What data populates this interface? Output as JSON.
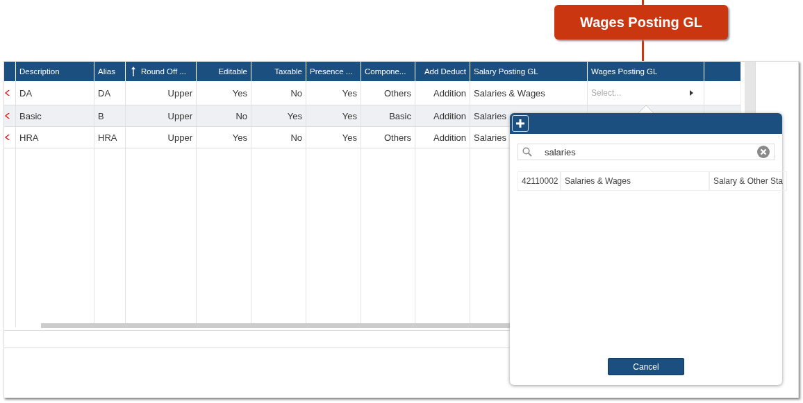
{
  "callout": {
    "text": "Wages Posting GL"
  },
  "table": {
    "columns": [
      {
        "label": "Description",
        "sorted": false
      },
      {
        "label": "Alias",
        "sorted": false
      },
      {
        "label": "Round Off ...",
        "sorted": true
      },
      {
        "label": "Editable",
        "sorted": false
      },
      {
        "label": "Taxable",
        "sorted": false
      },
      {
        "label": "Presence ...",
        "sorted": false
      },
      {
        "label": "Compone...",
        "sorted": false
      },
      {
        "label": "Add Deduct",
        "sorted": false
      },
      {
        "label": "Salary Posting GL",
        "sorted": false
      },
      {
        "label": "Wages Posting GL",
        "sorted": false
      }
    ],
    "rows": [
      {
        "selected": false,
        "cells": [
          "DA",
          "DA",
          "Upper",
          "Yes",
          "No",
          "Yes",
          "Others",
          "Addition",
          "Salaries & Wages"
        ],
        "wages_placeholder": "Select..."
      },
      {
        "selected": true,
        "cells": [
          "Basic",
          "B",
          "Upper",
          "No",
          "Yes",
          "Yes",
          "Basic",
          "Addition",
          "Salaries"
        ]
      },
      {
        "selected": false,
        "cells": [
          "HRA",
          "HRA",
          "Upper",
          "Yes",
          "No",
          "Yes",
          "Others",
          "Addition",
          "Salaries"
        ]
      }
    ]
  },
  "popup": {
    "search": {
      "value": "salaries"
    },
    "results": [
      {
        "cells": [
          "42110002",
          "Salaries & Wages",
          "Salary & Other Sta"
        ]
      }
    ],
    "cancel": "Cancel"
  }
}
